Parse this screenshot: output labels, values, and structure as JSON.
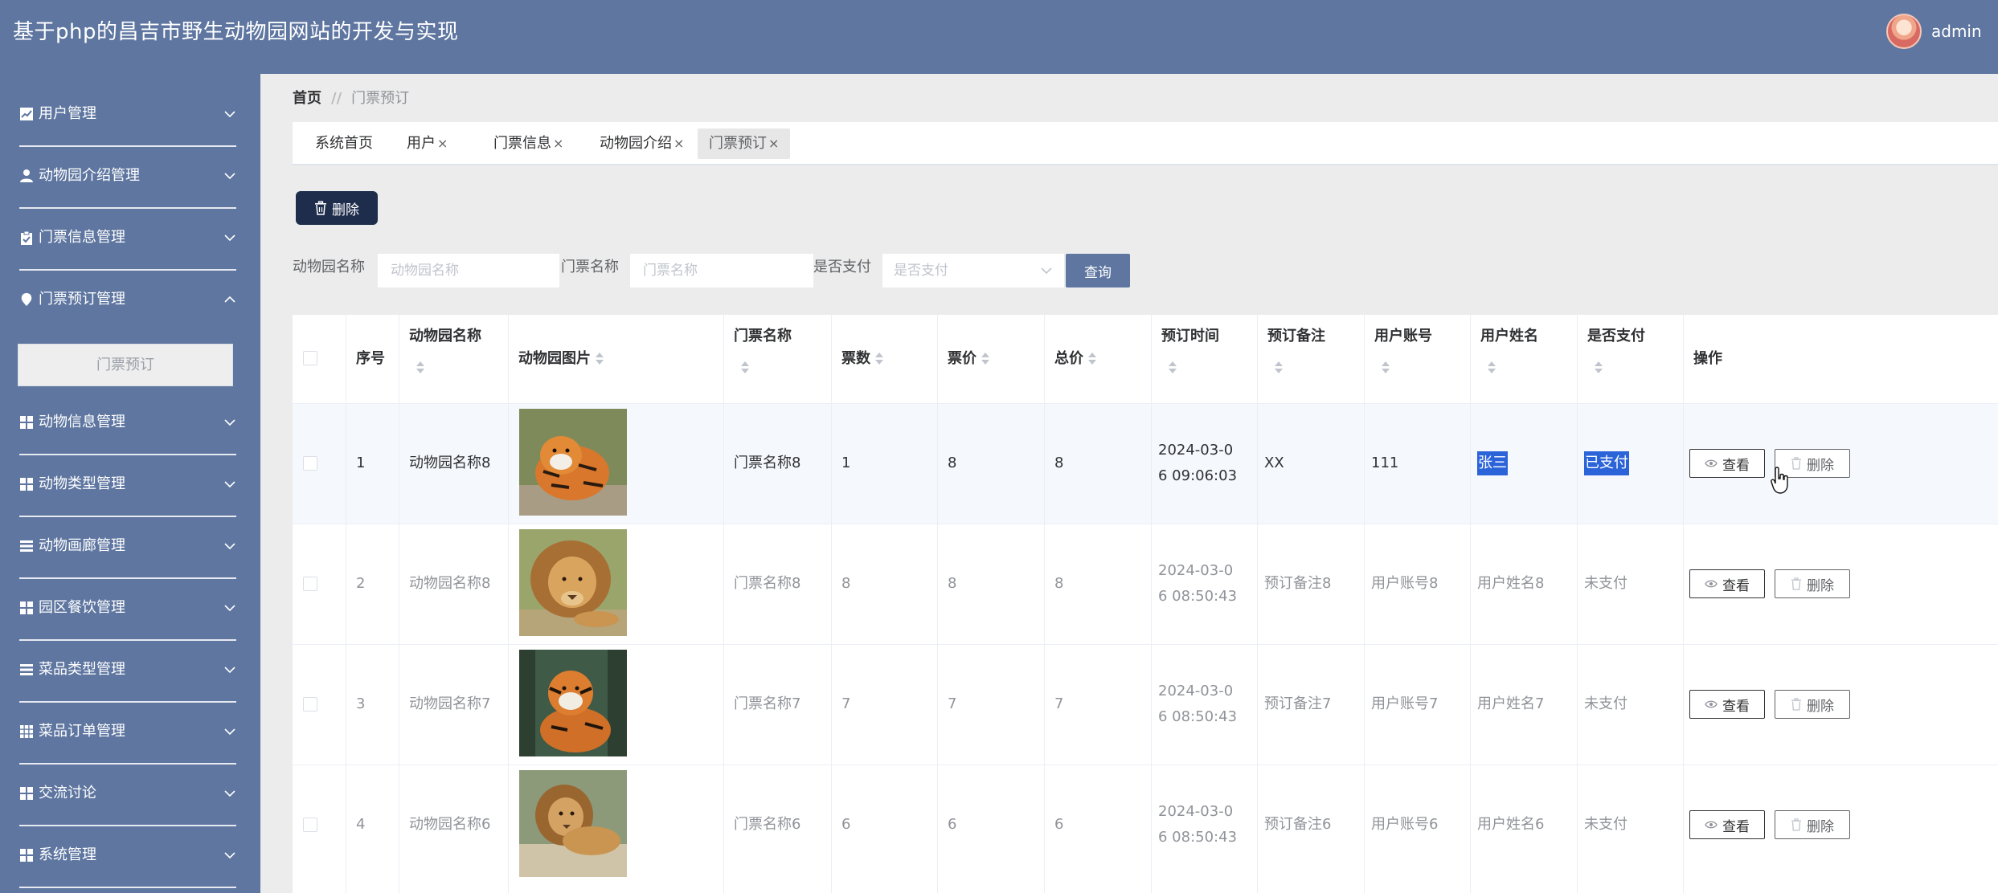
{
  "header": {
    "title": "基于php的昌吉市野生动物园网站的开发与实现",
    "user": "admin"
  },
  "sidebar": {
    "items": [
      {
        "label": "用户管理",
        "icon": "chart-icon",
        "expanded": false
      },
      {
        "label": "动物园介绍管理",
        "icon": "user-icon",
        "expanded": false
      },
      {
        "label": "门票信息管理",
        "icon": "clipboard-icon",
        "expanded": false
      },
      {
        "label": "门票预订管理",
        "icon": "location-pin-icon",
        "expanded": true
      },
      {
        "label": "动物信息管理",
        "icon": "grid-icon",
        "expanded": false
      },
      {
        "label": "动物类型管理",
        "icon": "grid-icon",
        "expanded": false
      },
      {
        "label": "动物画廊管理",
        "icon": "list-icon",
        "expanded": false
      },
      {
        "label": "园区餐饮管理",
        "icon": "grid-icon",
        "expanded": false
      },
      {
        "label": "菜品类型管理",
        "icon": "list-icon",
        "expanded": false
      },
      {
        "label": "菜品订单管理",
        "icon": "apps-icon",
        "expanded": false
      },
      {
        "label": "交流讨论",
        "icon": "grid-icon",
        "expanded": false
      },
      {
        "label": "系统管理",
        "icon": "grid-icon",
        "expanded": false
      }
    ],
    "submenu": {
      "label": "门票预订"
    }
  },
  "breadcrumb": {
    "home": "首页",
    "separator": "//",
    "current": "门票预订"
  },
  "tabs": [
    {
      "label": "系统首页",
      "closable": false
    },
    {
      "label": "用户",
      "closable": true
    },
    {
      "label": "门票信息",
      "closable": true
    },
    {
      "label": "动物园介绍",
      "closable": true
    },
    {
      "label": "门票预订",
      "closable": true,
      "active": true
    }
  ],
  "tab_close_glyph": "×",
  "toolbar": {
    "delete_label": "删除"
  },
  "filters": {
    "zoo_name_label": "动物园名称",
    "zoo_name_placeholder": "动物园名称",
    "ticket_name_label": "门票名称",
    "ticket_name_placeholder": "门票名称",
    "paid_label": "是否支付",
    "paid_placeholder": "是否支付",
    "query_label": "查询"
  },
  "table": {
    "headers": {
      "index": "序号",
      "zoo_name": "动物园名称",
      "zoo_image": "动物园图片",
      "ticket_name": "门票名称",
      "count": "票数",
      "price": "票价",
      "total": "总价",
      "time": "预订时间",
      "note": "预订备注",
      "account": "用户账号",
      "username": "用户姓名",
      "paid": "是否支付",
      "actions": "操作"
    },
    "view_label": "查看",
    "delete_label": "删除",
    "rows": [
      {
        "index": "1",
        "zoo_name": "动物园名称8",
        "image": "tiger",
        "ticket_name": "门票名称8",
        "count": "1",
        "price": "8",
        "total": "8",
        "time_l1": "2024-03-0",
        "time_l2": "6 09:06:03",
        "note": "XX",
        "account": "111",
        "username": "张三",
        "paid": "已支付"
      },
      {
        "index": "2",
        "zoo_name": "动物园名称8",
        "image": "lion",
        "ticket_name": "门票名称8",
        "count": "8",
        "price": "8",
        "total": "8",
        "time_l1": "2024-03-0",
        "time_l2": "6 08:50:43",
        "note": "预订备注8",
        "account": "用户账号8",
        "username": "用户姓名8",
        "paid": "未支付"
      },
      {
        "index": "3",
        "zoo_name": "动物园名称7",
        "image": "tiger",
        "ticket_name": "门票名称7",
        "count": "7",
        "price": "7",
        "total": "7",
        "time_l1": "2024-03-0",
        "time_l2": "6 08:50:43",
        "note": "预订备注7",
        "account": "用户账号7",
        "username": "用户姓名7",
        "paid": "未支付"
      },
      {
        "index": "4",
        "zoo_name": "动物园名称6",
        "image": "lion",
        "ticket_name": "门票名称6",
        "count": "6",
        "price": "6",
        "total": "6",
        "time_l1": "2024-03-0",
        "time_l2": "6 08:50:43",
        "note": "预订备注6",
        "account": "用户账号6",
        "username": "用户姓名6",
        "paid": "未支付"
      }
    ]
  },
  "colors": {
    "primary": "#5e76a0",
    "dark_button": "#1f2d4d",
    "selection": "#2b63d9"
  }
}
